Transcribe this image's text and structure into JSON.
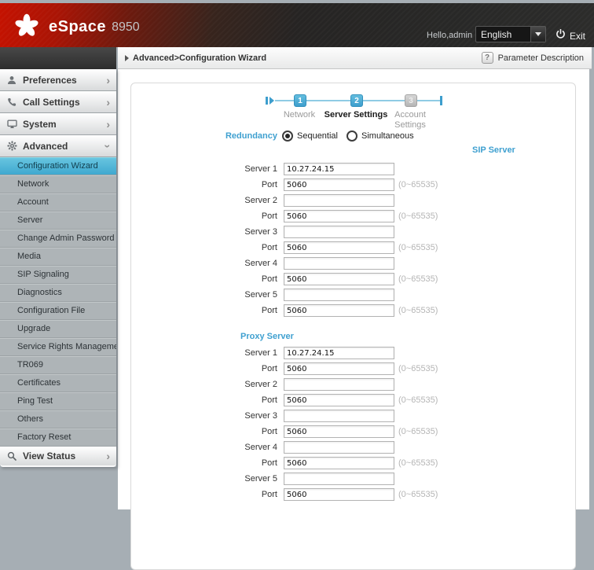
{
  "header": {
    "product": "eSpace",
    "model": "8950",
    "greeting": "Hello,admin",
    "language": "English",
    "exit_label": "Exit"
  },
  "breadcrumb": {
    "path": "Advanced>Configuration Wizard",
    "help": "?",
    "param_desc": "Parameter Description"
  },
  "sidebar": {
    "top_items": [
      {
        "label": "Preferences",
        "icon": "person-icon"
      },
      {
        "label": "Call Settings",
        "icon": "phone-icon"
      },
      {
        "label": "System",
        "icon": "monitor-icon"
      },
      {
        "label": "Advanced",
        "icon": "gear-icon"
      }
    ],
    "advanced_subitems": [
      "Configuration Wizard",
      "Network",
      "Account",
      "Server",
      "Change Admin Password",
      "Media",
      "SIP Signaling",
      "Diagnostics",
      "Configuration File",
      "Upgrade",
      "Service Rights Management",
      "TR069",
      "Certificates",
      "Ping Test",
      "Others",
      "Factory Reset"
    ],
    "selected_subitem": "Configuration Wizard",
    "bottom_item": {
      "label": "View Status",
      "icon": "magnifier-icon"
    }
  },
  "wizard": {
    "steps": [
      {
        "num": "1",
        "label": "Network",
        "state": "done"
      },
      {
        "num": "2",
        "label": "Server Settings",
        "state": "active"
      },
      {
        "num": "3",
        "label": "Account Settings",
        "state": "pending"
      }
    ]
  },
  "form": {
    "redundancy_label": "Redundancy",
    "radio_options": [
      {
        "label": "Sequential",
        "selected": true
      },
      {
        "label": "Simultaneous",
        "selected": false
      }
    ],
    "sip": {
      "title": "SIP Server",
      "rows": [
        {
          "label": "Server 1",
          "value": "10.27.24.15"
        },
        {
          "label": "Port",
          "value": "5060",
          "hint": "(0~65535)"
        },
        {
          "label": "Server 2",
          "value": ""
        },
        {
          "label": "Port",
          "value": "5060",
          "hint": "(0~65535)"
        },
        {
          "label": "Server 3",
          "value": ""
        },
        {
          "label": "Port",
          "value": "5060",
          "hint": "(0~65535)"
        },
        {
          "label": "Server 4",
          "value": ""
        },
        {
          "label": "Port",
          "value": "5060",
          "hint": "(0~65535)"
        },
        {
          "label": "Server 5",
          "value": ""
        },
        {
          "label": "Port",
          "value": "5060",
          "hint": "(0~65535)"
        }
      ]
    },
    "proxy": {
      "title": "Proxy Server",
      "rows": [
        {
          "label": "Server 1",
          "value": "10.27.24.15"
        },
        {
          "label": "Port",
          "value": "5060",
          "hint": "(0~65535)"
        },
        {
          "label": "Server 2",
          "value": ""
        },
        {
          "label": "Port",
          "value": "5060",
          "hint": "(0~65535)"
        },
        {
          "label": "Server 3",
          "value": ""
        },
        {
          "label": "Port",
          "value": "5060",
          "hint": "(0~65535)"
        },
        {
          "label": "Server 4",
          "value": ""
        },
        {
          "label": "Port",
          "value": "5060",
          "hint": "(0~65535)"
        },
        {
          "label": "Server 5",
          "value": ""
        },
        {
          "label": "Port",
          "value": "5060",
          "hint": "(0~65535)"
        }
      ]
    }
  },
  "colors": {
    "accent_blue": "#3fa0d0",
    "selected_item_top": "#69c6e0",
    "selected_item_bottom": "#3fa8cf",
    "header_red": "#c51200",
    "sidebar_sub_bg": "#aeb4b7"
  }
}
